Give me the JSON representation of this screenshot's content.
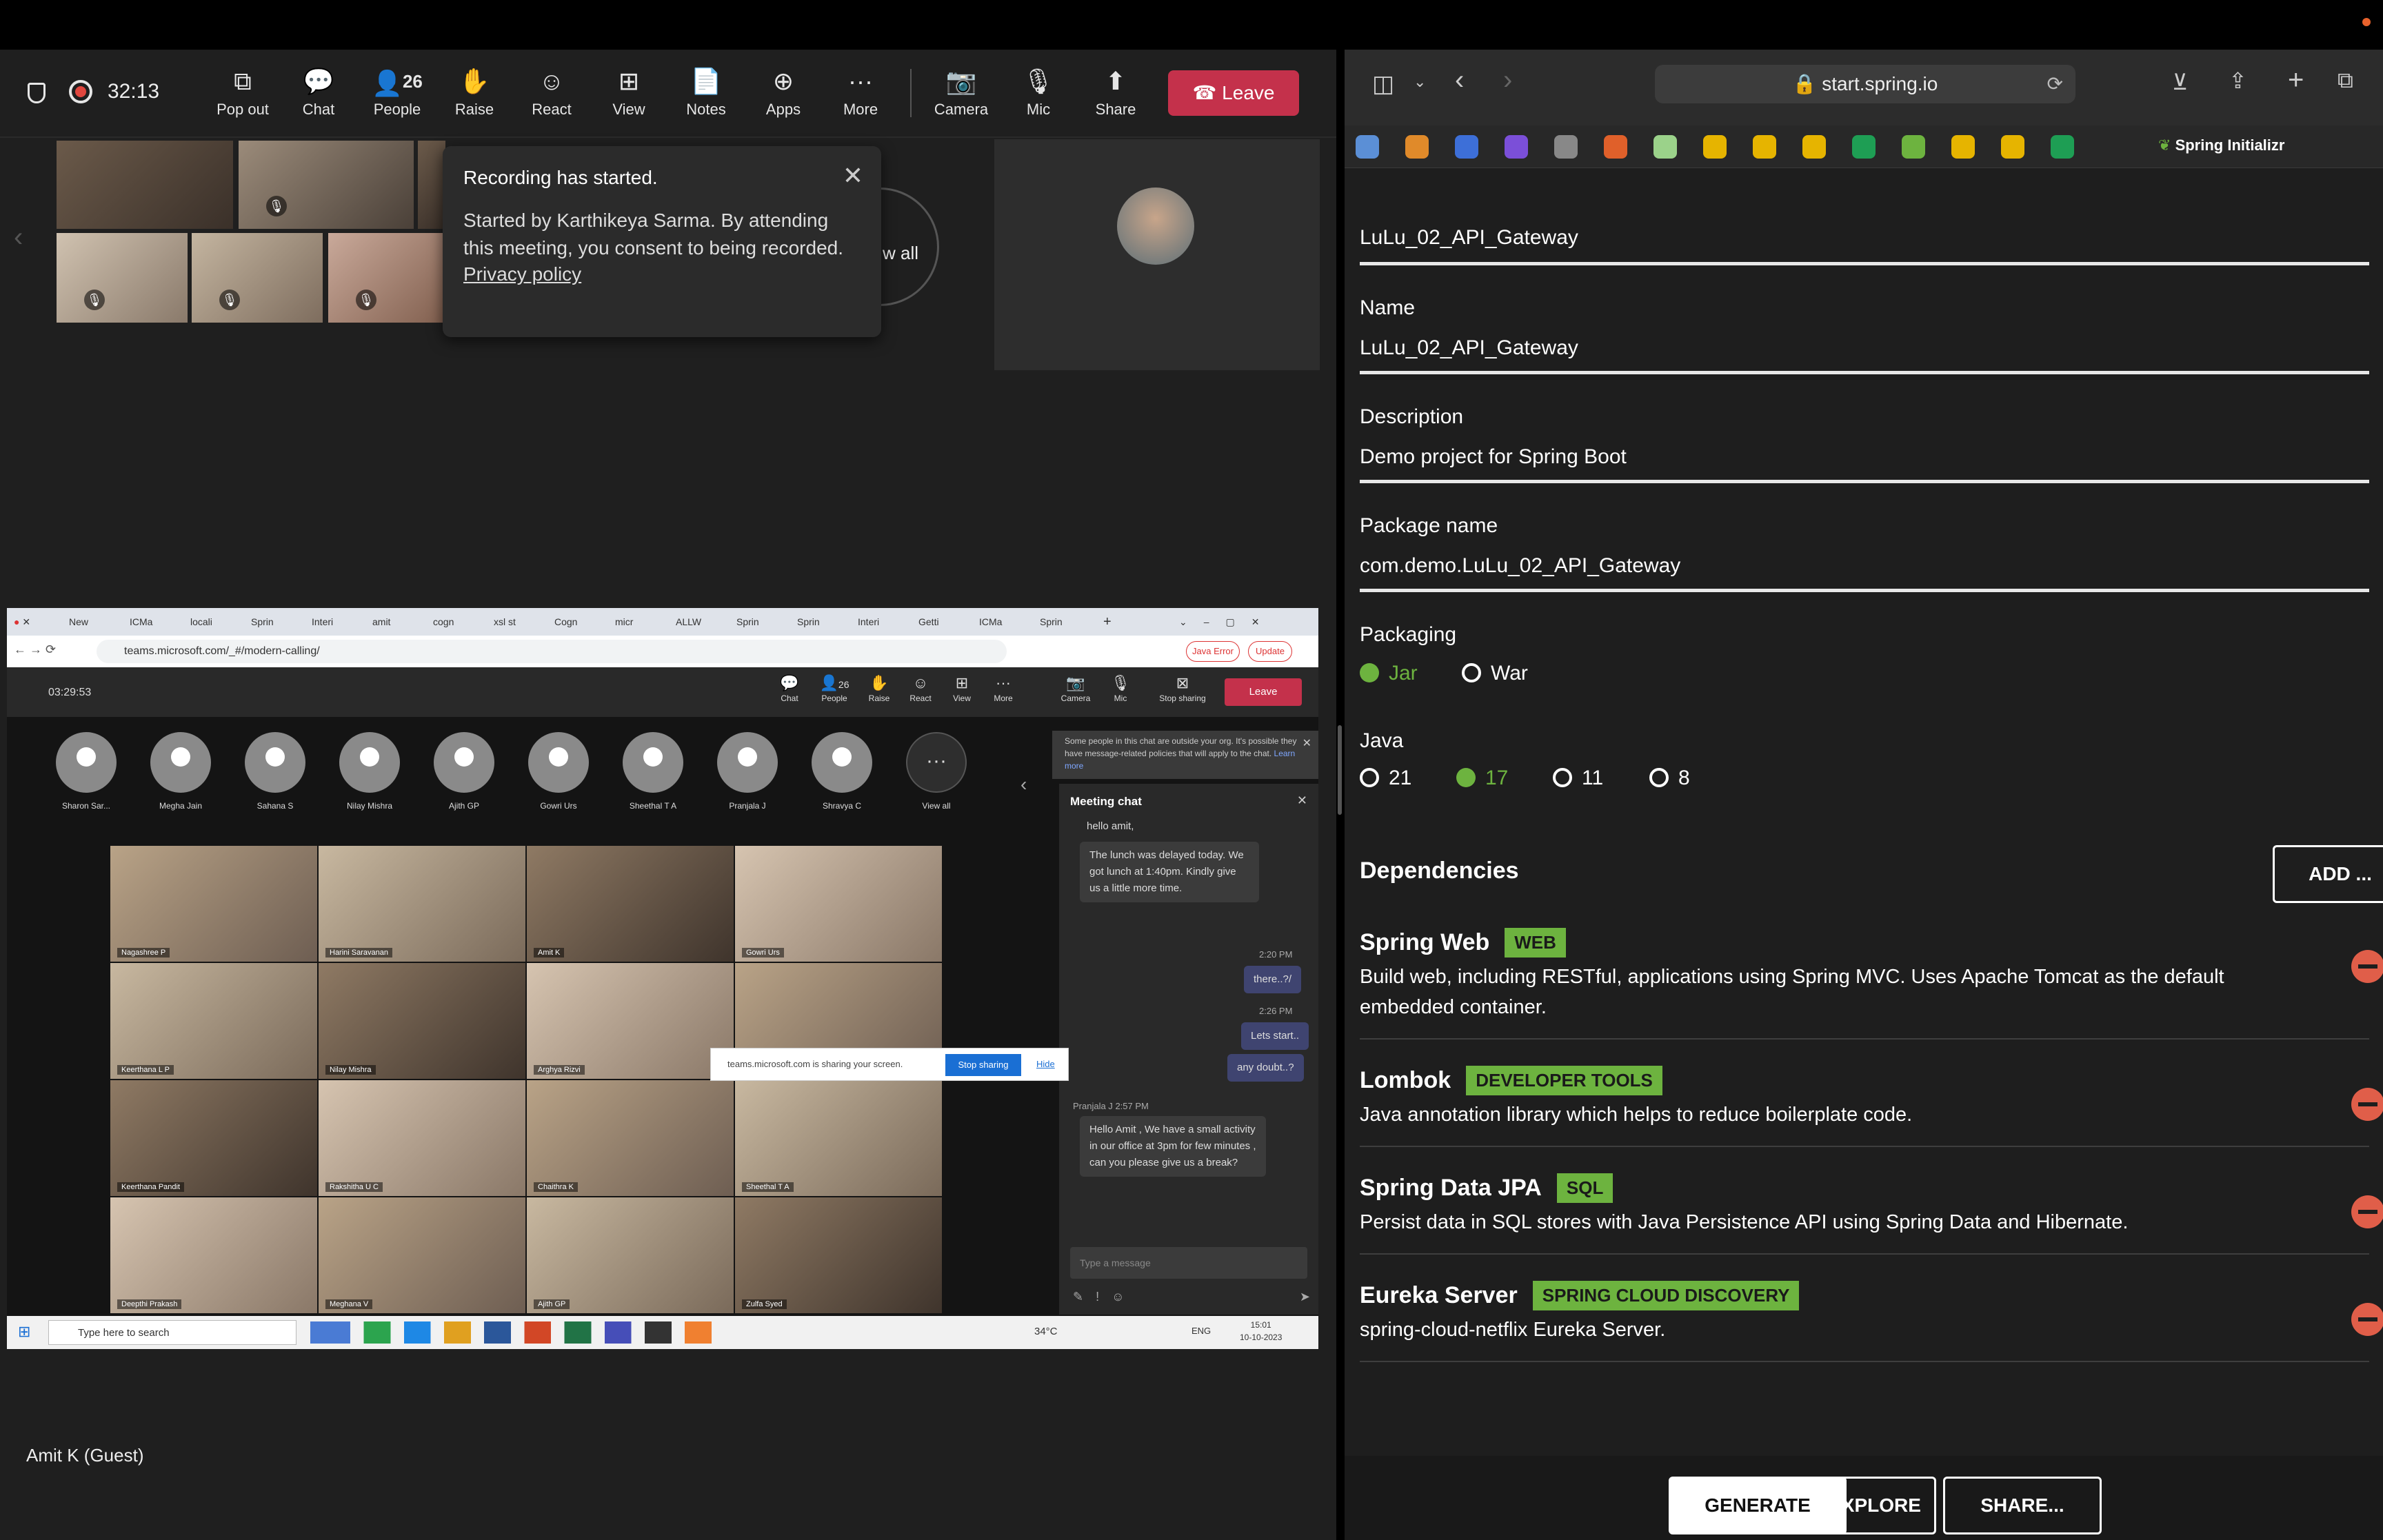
{
  "teams": {
    "timer": "32:13",
    "toolbar": {
      "popout": "Pop out",
      "chat": "Chat",
      "people_count": "26",
      "people": "People",
      "raise": "Raise",
      "react": "React",
      "view": "View",
      "notes": "Notes",
      "apps": "Apps",
      "more": "More",
      "camera": "Camera",
      "mic": "Mic",
      "share": "Share",
      "leave": "Leave"
    },
    "recording_toast": {
      "title": "Recording has started.",
      "body": "Started by Karthikeya Sarma. By attending this meeting, you consent to being recorded.",
      "link": "Privacy policy"
    },
    "view_all": "w all",
    "guest_label": "Amit K (Guest)"
  },
  "shared_screen": {
    "tabs": [
      "New",
      "ICMa",
      "locali",
      "Sprin",
      "Interi",
      "amit",
      "cogn",
      "xsl st",
      "Cogn",
      "micr",
      "ALLW",
      "Sprin",
      "Sprin",
      "Interi",
      "Getti",
      "ICMa",
      "Sprin"
    ],
    "url": "teams.microsoft.com/_#/modern-calling/",
    "java_error": "Java Error",
    "update": "Update",
    "timer": "03:29:53",
    "toolbar": {
      "chat": "Chat",
      "people_count": "26",
      "people": "People",
      "raise": "Raise",
      "react": "React",
      "view": "View",
      "more": "More",
      "camera": "Camera",
      "mic": "Mic",
      "stop_sharing": "Stop sharing",
      "leave": "Leave"
    },
    "participants": [
      "Sharon Sar...",
      "Megha Jain",
      "Sahana S",
      "Nilay Mishra",
      "Ajith GP",
      "Gowri Urs",
      "Sheethal T A",
      "Pranjala J",
      "Shravya C",
      "View all"
    ],
    "video_tiles": [
      "Nagashree P",
      "Harini Saravanan",
      "Amit K",
      "Gowri Urs",
      "Keerthana L P",
      "Nilay Mishra",
      "Arghya Rizvi",
      "",
      "Keerthana Pandit",
      "Rakshitha U C",
      "Chaithra K",
      "Sheethal T A",
      "Deepthi Prakash",
      "Meghana V",
      "Ajith GP",
      "Zulfa Syed"
    ],
    "chat_notice": "Some people in this chat are outside your org. It's possible they have message-related policies that will apply to the chat.",
    "chat_notice_link": "Learn more",
    "chat_title": "Meeting chat",
    "messages": {
      "m1": "hello amit,",
      "m2": "The lunch was delayed today. We got lunch at 1:40pm. Kindly give us a little more time.",
      "t1": "2:20 PM",
      "m3": "there..?/",
      "t2": "2:26 PM",
      "m4": "Lets start..",
      "m5": "any doubt..?",
      "sender": "Pranjala J",
      "t3": "2:57 PM",
      "m6": "Hello Amit , We have a small activity in our office at 3pm for few minutes , can you please give us a break?"
    },
    "chat_placeholder": "Type a message",
    "share_banner": "teams.microsoft.com is sharing your screen.",
    "stop_sharing_btn": "Stop sharing",
    "hide": "Hide",
    "taskbar": {
      "search": "Type here to search",
      "temp": "34°C",
      "lang": "ENG",
      "time": "15:01",
      "date": "10-10-2023"
    }
  },
  "safari": {
    "url": "start.spring.io",
    "active_tab": "Spring Initializr"
  },
  "initializr": {
    "artifact_value": "LuLu_02_API_Gateway",
    "name_label": "Name",
    "name_value": "LuLu_02_API_Gateway",
    "description_label": "Description",
    "description_value": "Demo project for Spring Boot",
    "package_label": "Package name",
    "package_value": "com.demo.LuLu_02_API_Gateway",
    "packaging_label": "Packaging",
    "packaging": [
      "Jar",
      "War"
    ],
    "java_label": "Java",
    "java": [
      "21",
      "17",
      "11",
      "8"
    ],
    "dependencies_title": "Dependencies",
    "add_label": "ADD ...",
    "dependencies": [
      {
        "name": "Spring Web",
        "tag": "WEB",
        "desc": "Build web, including RESTful, applications using Spring MVC. Uses Apache Tomcat as the default embedded container."
      },
      {
        "name": "Lombok",
        "tag": "DEVELOPER TOOLS",
        "desc": "Java annotation library which helps to reduce boilerplate code."
      },
      {
        "name": "Spring Data JPA",
        "tag": "SQL",
        "desc": "Persist data in SQL stores with Java Persistence API using Spring Data and Hibernate."
      },
      {
        "name": "Eureka Server",
        "tag": "SPRING CLOUD DISCOVERY",
        "desc": "spring-cloud-netflix Eureka Server."
      }
    ],
    "buttons": {
      "generate": "GENERATE",
      "explore": "EXPLORE",
      "share": "SHARE..."
    }
  },
  "colors": {
    "spring_green": "#6db33f",
    "leave_red": "#c4314b",
    "remove_red": "#e05e49"
  }
}
